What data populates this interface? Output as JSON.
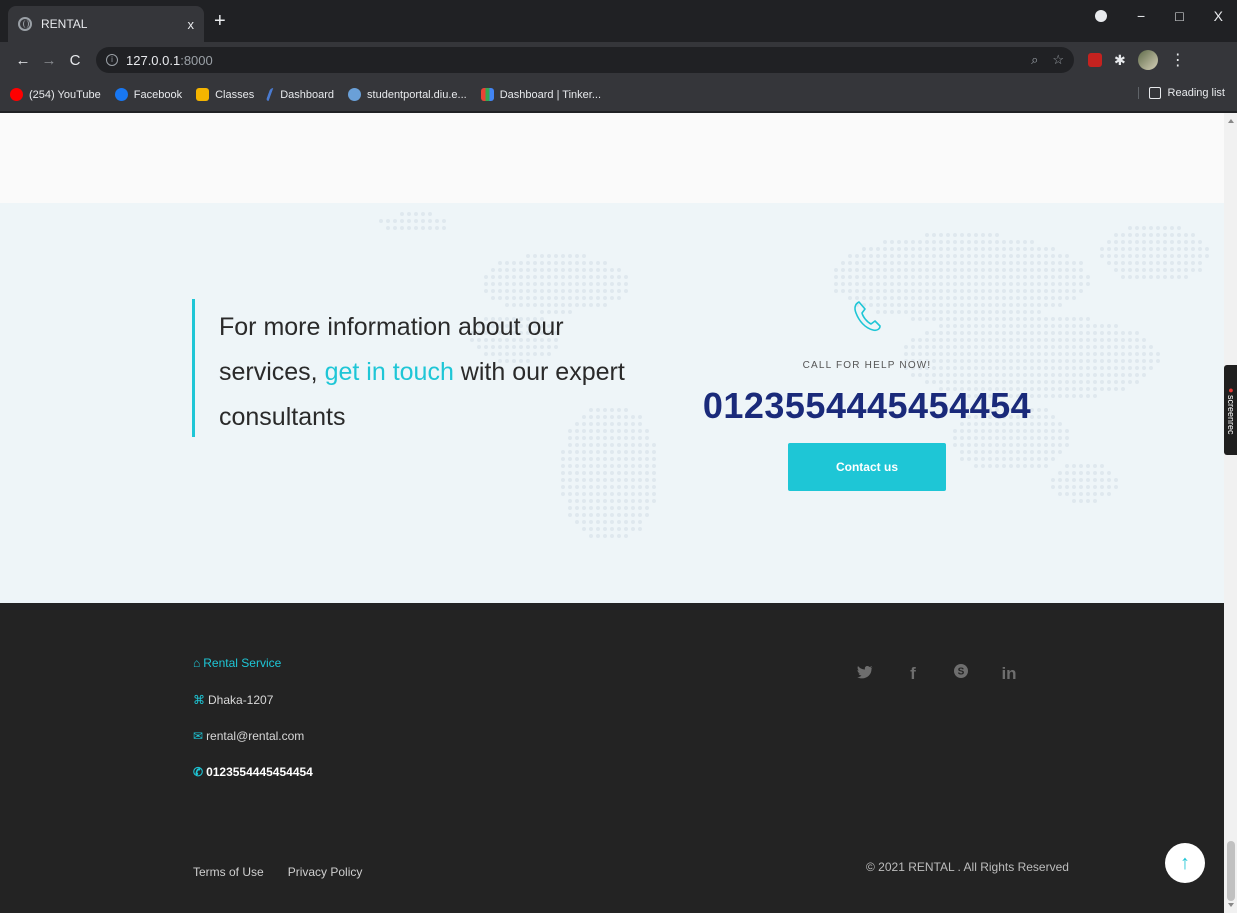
{
  "browser": {
    "tab_title": "RENTAL",
    "tab_close": "x",
    "new_tab": "+",
    "url_host": "127.0.0.1",
    "url_port": ":8000",
    "window_controls": {
      "minimize": "−",
      "maximize": "□",
      "close": "X"
    },
    "bookmarks": [
      {
        "label": "(254) YouTube",
        "icon": "youtube-icon"
      },
      {
        "label": "Facebook",
        "icon": "facebook-icon"
      },
      {
        "label": "Classes",
        "icon": "classes-icon"
      },
      {
        "label": "Dashboard",
        "icon": "dashboard-icon"
      },
      {
        "label": "studentportal.diu.e...",
        "icon": "studentportal-icon"
      },
      {
        "label": "Dashboard | Tinker...",
        "icon": "tinkercad-icon"
      }
    ],
    "reading_list": "Reading list"
  },
  "cta": {
    "text_before": "For more information about our services, ",
    "text_accent": "get in touch",
    "text_after": " with our expert consultants",
    "call_label": "CALL FOR HELP NOW!",
    "phone_number": "0123554445454454",
    "contact_button": "Contact us"
  },
  "footer": {
    "brand": "Rental Service",
    "address": "Dhaka-1207",
    "email": "rental@rental.com",
    "phone": "0123554445454454",
    "socials": [
      {
        "name": "twitter-icon",
        "glyph": "🐦"
      },
      {
        "name": "facebook-icon",
        "glyph": "f"
      },
      {
        "name": "skype-icon",
        "glyph": "S"
      },
      {
        "name": "linkedin-icon",
        "glyph": "in"
      }
    ],
    "links": {
      "terms": "Terms of Use",
      "privacy": "Privacy Policy"
    },
    "copyright": "© 2021 RENTAL . All Rights Reserved",
    "back_to_top": "↑"
  },
  "overlay": {
    "screenrec": "screenrec"
  },
  "colors": {
    "accent": "#1ec6d6",
    "phone_number": "#1a2a7a",
    "footer_bg": "#232323",
    "cta_bg": "#eef5f8"
  }
}
